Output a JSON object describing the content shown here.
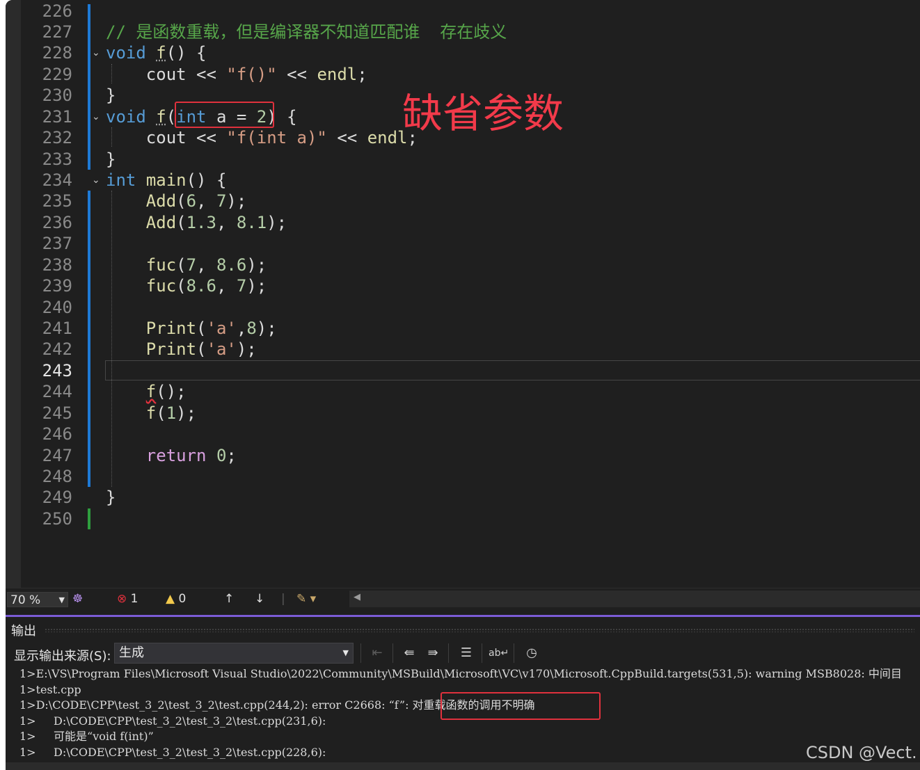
{
  "editor": {
    "lines": [
      {
        "num": "226",
        "text": ""
      },
      {
        "num": "227",
        "text": "// 是函数重载，但是编译器不知道匹配谁  存在歧义"
      },
      {
        "num": "228",
        "text": "void f() {"
      },
      {
        "num": "229",
        "text": "    cout << \"f()\" << endl;"
      },
      {
        "num": "230",
        "text": "}"
      },
      {
        "num": "231",
        "text": "void f(int a = 2) {"
      },
      {
        "num": "232",
        "text": "    cout << \"f(int a)\" << endl;"
      },
      {
        "num": "233",
        "text": "}"
      },
      {
        "num": "234",
        "text": "int main() {"
      },
      {
        "num": "235",
        "text": "    Add(6, 7);"
      },
      {
        "num": "236",
        "text": "    Add(1.3, 8.1);"
      },
      {
        "num": "237",
        "text": ""
      },
      {
        "num": "238",
        "text": "    fuc(7, 8.6);"
      },
      {
        "num": "239",
        "text": "    fuc(8.6, 7);"
      },
      {
        "num": "240",
        "text": ""
      },
      {
        "num": "241",
        "text": "    Print('a',8);"
      },
      {
        "num": "242",
        "text": "    Print('a');"
      },
      {
        "num": "243",
        "text": ""
      },
      {
        "num": "244",
        "text": "    f();"
      },
      {
        "num": "245",
        "text": "    f(1);"
      },
      {
        "num": "246",
        "text": ""
      },
      {
        "num": "247",
        "text": "    return 0;"
      },
      {
        "num": "248",
        "text": ""
      },
      {
        "num": "249",
        "text": "}"
      },
      {
        "num": "250",
        "text": ""
      }
    ],
    "annotation": "缺省参数"
  },
  "status": {
    "zoom": "70 %",
    "errors": "1",
    "warnings": "0"
  },
  "output": {
    "title": "输出",
    "source_label": "显示输出来源(S):",
    "source_value": "生成",
    "lines": [
      "1>E:\\VS\\Program Files\\Microsoft Visual Studio\\2022\\Community\\MSBuild\\Microsoft\\VC\\v170\\Microsoft.CppBuild.targets(531,5): warning MSB8028: 中间目",
      "1>test.cpp",
      "1>D:\\CODE\\CPP\\test_3_2\\test_3_2\\test.cpp(244,2): error C2668: “f”: 对重载函数的调用不明确",
      "1>     D:\\CODE\\CPP\\test_3_2\\test_3_2\\test.cpp(231,6):",
      "1>     可能是“void f(int)”",
      "1>     D:\\CODE\\CPP\\test_3_2\\test_3_2\\test.cpp(228,6):"
    ]
  },
  "watermark": "CSDN @Vect."
}
